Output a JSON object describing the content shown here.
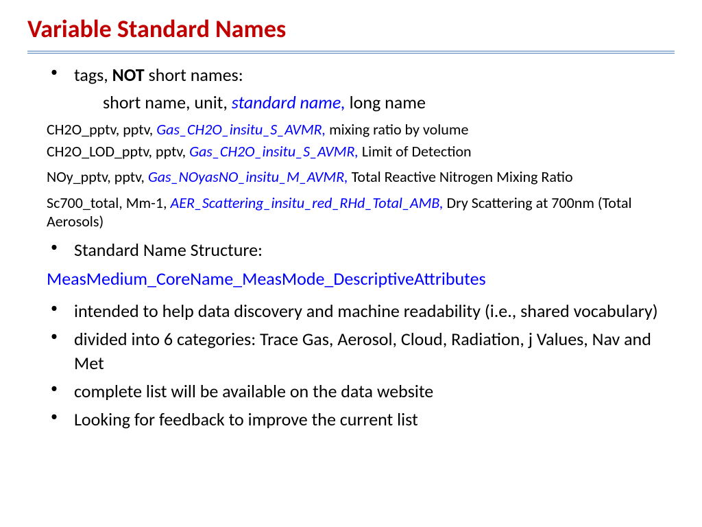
{
  "title": "Variable Standard Names",
  "bullet1": {
    "pre": "tags, ",
    "bold": "NOT",
    "post": " short names:"
  },
  "indent_line": {
    "pre": "short name, unit, ",
    "blue": "standard name,",
    "post": " long name"
  },
  "examples": {
    "e1": {
      "pre": "CH2O_pptv, pptv, ",
      "blue": "Gas_CH2O_insitu_S_AVMR,",
      "post": " mixing ratio by volume"
    },
    "e2": {
      "pre": "CH2O_LOD_pptv, pptv, ",
      "blue": "Gas_CH2O_insitu_S_AVMR,",
      "post": " Limit of Detection"
    },
    "e3": {
      "pre": "NOy_pptv, pptv, ",
      "blue": "Gas_NOyasNO_insitu_M_AVMR,",
      "post": " Total Reactive Nitrogen Mixing Ratio"
    },
    "e4": {
      "pre": "Sc700_total, Mm-1, ",
      "blue": "AER_Scattering_insitu_red_RHd_Total_AMB,",
      "post": " Dry Scattering at 700nm (Total Aerosols)"
    }
  },
  "bullet2": "Standard Name Structure:",
  "structure": "MeasMedium_CoreName_MeasMode_DescriptiveAttributes",
  "bullet3": "intended to help data discovery and machine readability (i.e., shared vocabulary)",
  "bullet4": "divided into 6 categories: Trace Gas, Aerosol, Cloud, Radiation, j Values, Nav and Met",
  "bullet5": "complete list will be available on the data website",
  "bullet6": "Looking for feedback to improve the current list"
}
